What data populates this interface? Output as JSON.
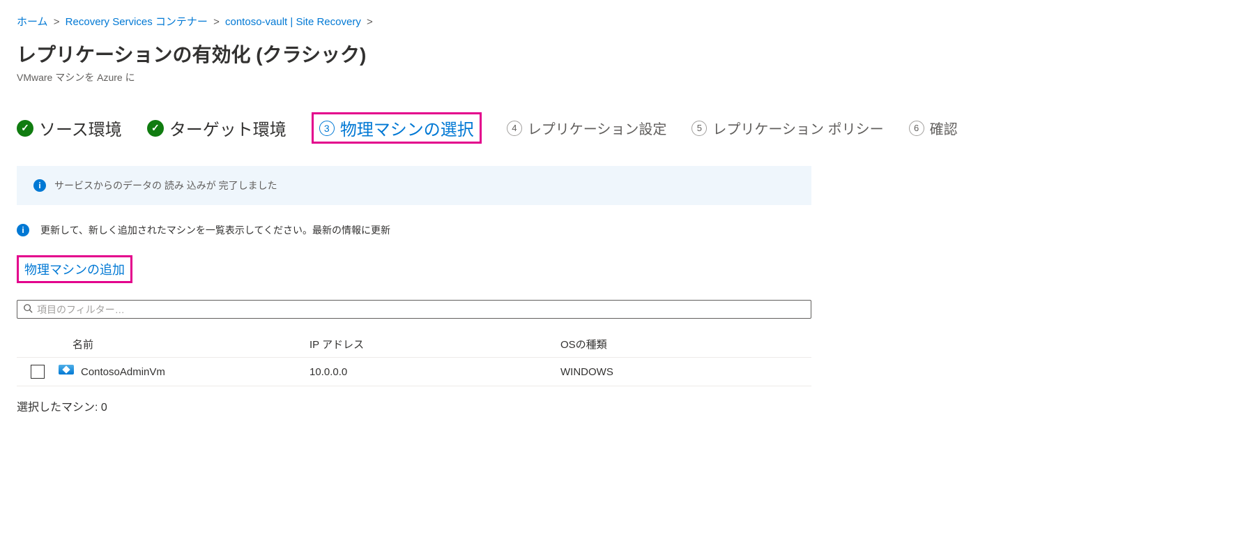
{
  "breadcrumb": {
    "home": "ホーム",
    "rsv": "Recovery Services コンテナー",
    "vault": "contoso-vault | Site Recovery"
  },
  "page": {
    "title": "レプリケーションの有効化 (クラシック)",
    "subtitle": "VMware マシンを Azure に"
  },
  "steps": {
    "s1": "ソース環境",
    "s2": "ターゲット環境",
    "s3num": "3",
    "s3": "物理マシンの選択",
    "s4num": "4",
    "s4": "レプリケーション設定",
    "s5num": "5",
    "s5": "レプリケーション ポリシー",
    "s6num": "6",
    "s6": "確認"
  },
  "banner": {
    "text": "サービスからのデータの 読み 込みが 完了しました"
  },
  "refresh_hint": "更新して、新しく追加されたマシンを一覧表示してください。最新の情報に更新",
  "add_machine": "物理マシンの追加",
  "filter": {
    "placeholder": "項目のフィルター…"
  },
  "table": {
    "headers": {
      "name": "名前",
      "ip": "IP アドレス",
      "os": "OSの種類"
    },
    "rows": [
      {
        "name": "ContosoAdminVm",
        "ip": "10.0.0.0",
        "os": "WINDOWS"
      }
    ]
  },
  "selection": {
    "label_prefix": "選択したマシン: ",
    "count": "0"
  }
}
